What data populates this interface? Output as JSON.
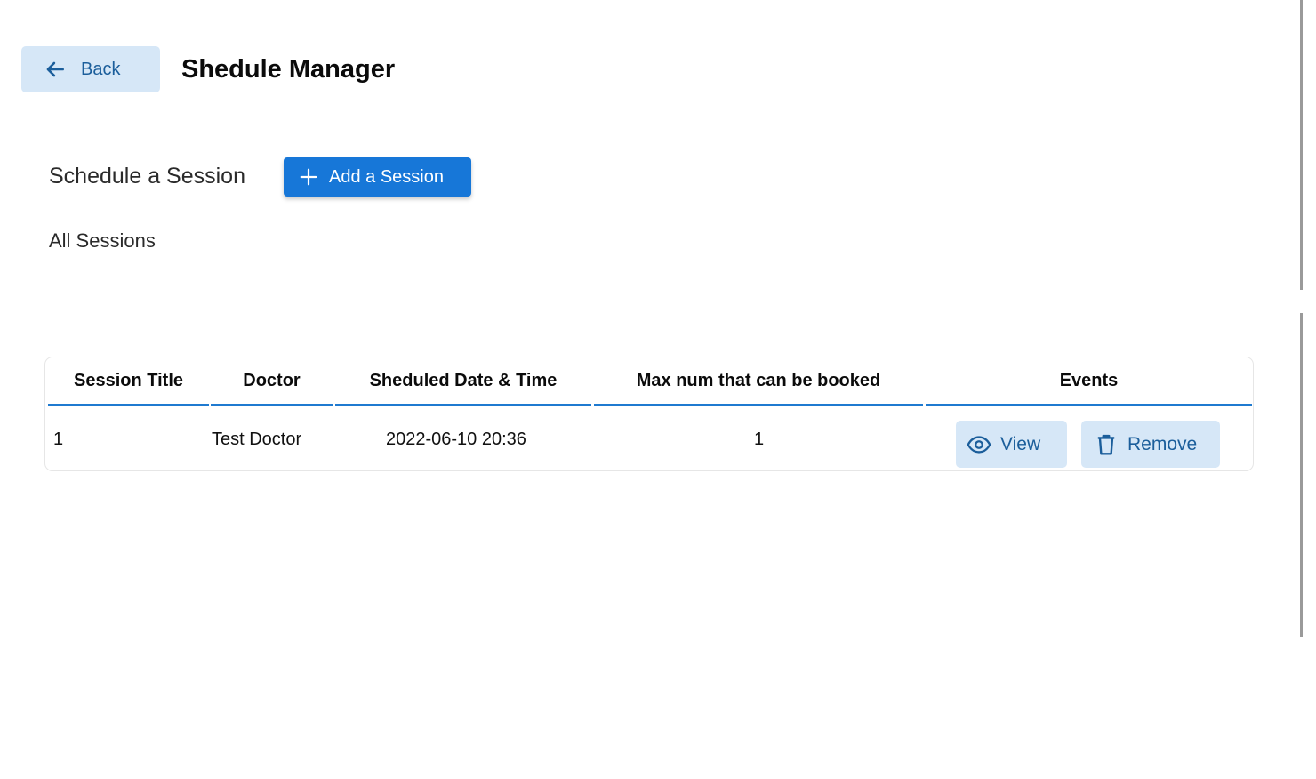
{
  "header": {
    "back_label": "Back",
    "title": "Shedule Manager"
  },
  "schedule": {
    "label": "Schedule a Session",
    "add_button_label": "Add a Session"
  },
  "sessions": {
    "heading": "All Sessions",
    "columns": [
      "Session Title",
      "Doctor",
      "Sheduled Date & Time",
      "Max num that can be booked",
      "Events"
    ],
    "rows": [
      {
        "title": "1",
        "doctor": "Test Doctor",
        "datetime": "2022-06-10 20:36",
        "max_booked": "1",
        "view_label": "View",
        "remove_label": "Remove"
      }
    ]
  },
  "icons": {
    "back": "arrow-left-icon",
    "add": "plus-icon",
    "view": "eye-icon",
    "remove": "trash-icon"
  },
  "colors": {
    "primary": "#1777d8",
    "primary_soft": "#d6e7f7",
    "primary_text": "#1b5e9b",
    "header_underline": "#1f7ad0"
  }
}
